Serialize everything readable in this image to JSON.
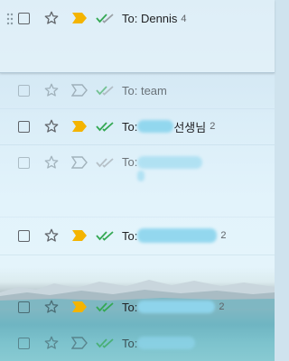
{
  "rows": [
    {
      "to_prefix": "To: Dennis",
      "count": "4",
      "important": true,
      "ticks": "green-gray"
    },
    {
      "to_prefix": "To: team",
      "count": "",
      "important": false,
      "ticks": "green-gray"
    },
    {
      "to_prefix": "To: ",
      "suffix": "선생님",
      "count": "2",
      "important": true,
      "ticks": "green"
    },
    {
      "to_prefix": "To: ",
      "suffix": "",
      "count": "",
      "important": false,
      "ticks": "gray"
    },
    {
      "to_prefix": "To: ",
      "suffix": "",
      "count": "2",
      "important": true,
      "ticks": "green"
    },
    {
      "to_prefix": "To: ",
      "suffix": "",
      "count": "2",
      "important": true,
      "ticks": "green"
    },
    {
      "to_prefix": "To: ",
      "suffix": "",
      "count": "",
      "important": false,
      "ticks": "green"
    }
  ],
  "colors": {
    "important": "#f4b400",
    "tick_green": "#34a853",
    "tick_gray": "#9aa0a6",
    "redaction": "#8fd6ee"
  },
  "icons": {
    "drag": "drag-handle-icon",
    "checkbox": "checkbox-icon",
    "star": "star-icon",
    "important": "important-marker-icon",
    "sent": "double-check-icon"
  }
}
